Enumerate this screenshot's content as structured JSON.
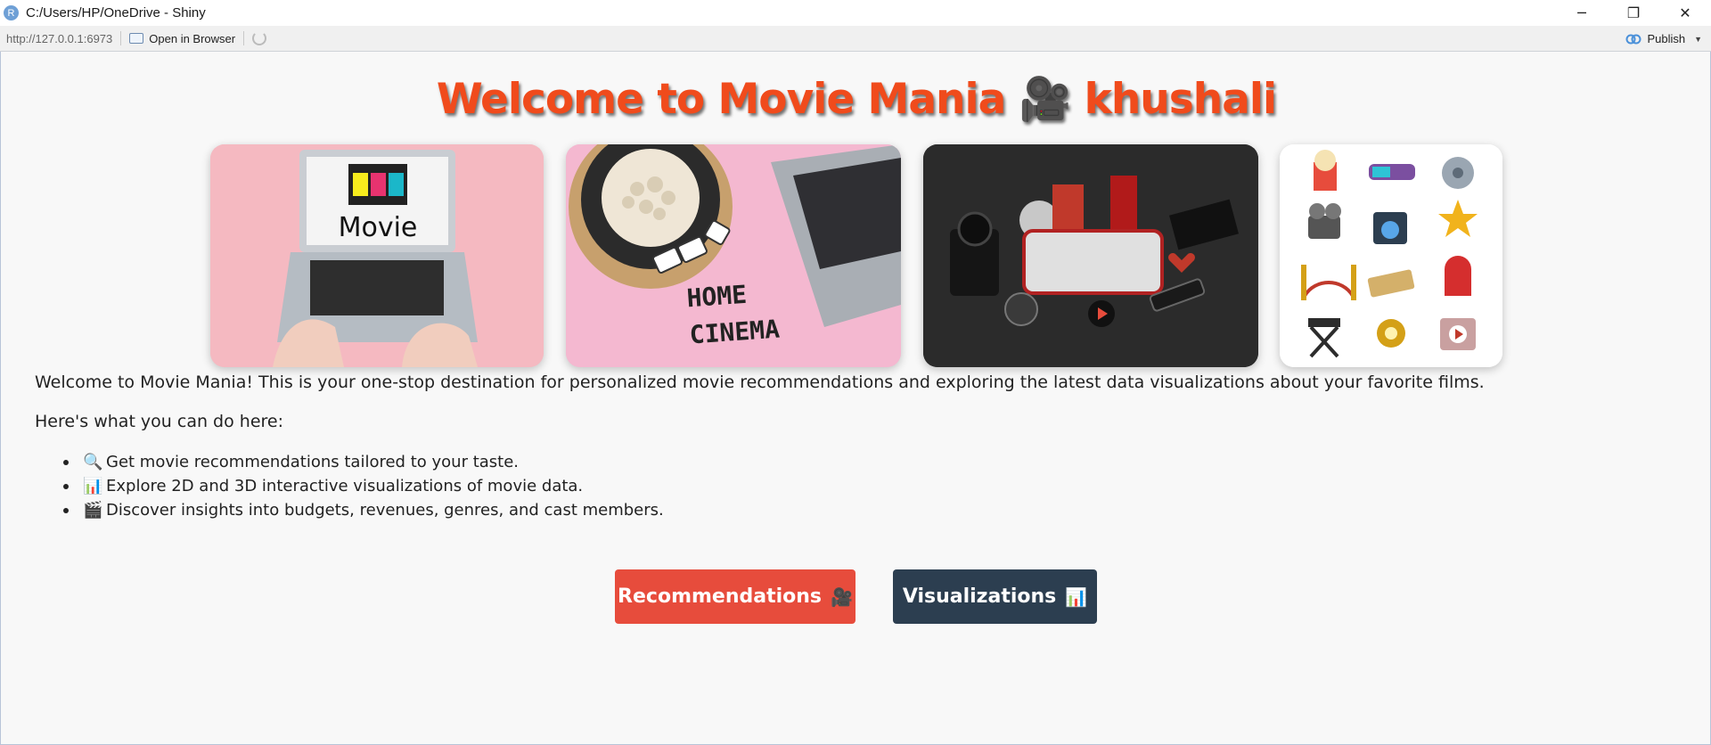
{
  "window": {
    "title": "C:/Users/HP/OneDrive - Shiny",
    "app_icon_letter": "R",
    "minimize": "─",
    "restore": "❐",
    "close": "✕"
  },
  "toolbar": {
    "url": "http://127.0.0.1:6973",
    "open_in_browser": "Open in Browser",
    "publish": "Publish"
  },
  "page": {
    "heading": "Welcome to Movie Mania 🎥 khushali",
    "intro": "Welcome to Movie Mania! This is your one-stop destination for personalized movie recommendations and exploring the latest data visualizations about your favorite films.",
    "subhead": "Here's what you can do here:",
    "features": [
      {
        "icon": "🔍",
        "text": "Get movie recommendations tailored to your taste."
      },
      {
        "icon": "📊",
        "text": "Explore 2D and 3D interactive visualizations of movie data."
      },
      {
        "icon": "🎬",
        "text": "Discover insights into budgets, revenues, genres, and cast members."
      }
    ],
    "images": [
      {
        "name": "laptop-movie-image",
        "overlay_text": "Movie"
      },
      {
        "name": "home-cinema-image",
        "overlay_text": "HOME CINEMA"
      },
      {
        "name": "cinema-props-image",
        "overlay_text": ""
      },
      {
        "name": "cinema-icons-image",
        "overlay_text": ""
      }
    ],
    "buttons": {
      "recommendations": "Recommendations",
      "recommendations_icon": "🎥",
      "visualizations": "Visualizations",
      "visualizations_icon": "📊"
    }
  },
  "colors": {
    "heading": "#f04b1c",
    "recommendations_button": "#e74c3c",
    "visualizations_button": "#2c3e50"
  }
}
